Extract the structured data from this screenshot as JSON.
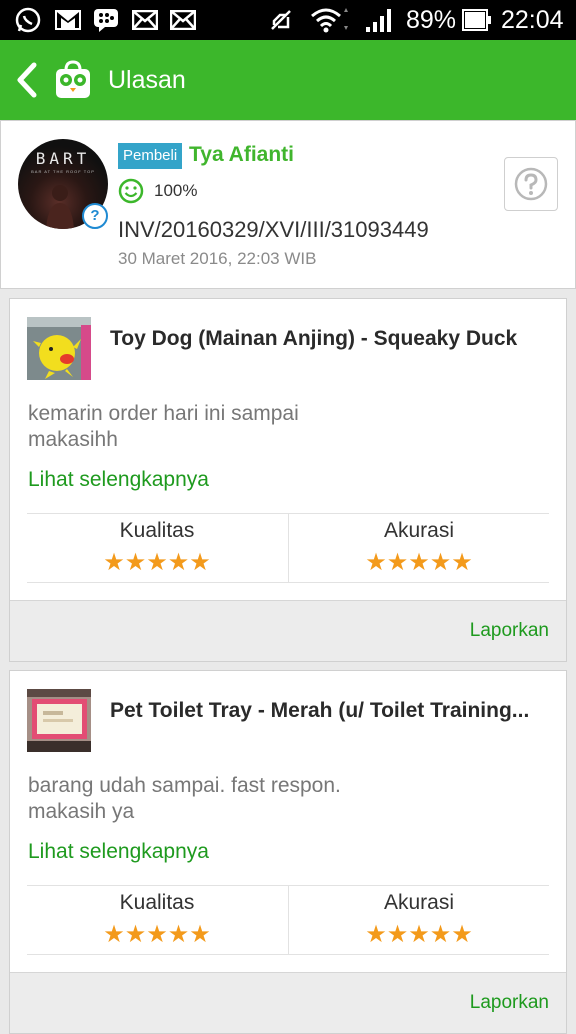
{
  "status_bar": {
    "battery": "89%",
    "time": "22:04",
    "icons": [
      "whatsapp-icon",
      "gmail-icon",
      "bbm-icon",
      "mail-icon",
      "mail-icon",
      "mute-icon",
      "wifi-icon",
      "signal-icon",
      "battery-icon"
    ]
  },
  "app_bar": {
    "title": "Ulasan",
    "back_icon": "back-arrow-icon",
    "logo_icon": "owl-bag-logo-icon",
    "color": "#3cb72b"
  },
  "reviewer": {
    "avatar_text": "BART",
    "avatar_subtext": "BAR AT THE ROOF TOP",
    "role_tag": "Pembeli",
    "name": "Tya Afianti",
    "reputation": "100%",
    "invoice": "INV/20160329/XVI/III/31093449",
    "date": "30 Maret 2016, 22:03 WIB"
  },
  "reviews": [
    {
      "product": "Toy Dog (Mainan Anjing) - Squeaky Duck",
      "message_line1": "kemarin order hari ini sampai",
      "message_line2": "makasihh",
      "more_label": "Lihat selengkapnya",
      "quality_label": "Kualitas",
      "quality_stars": 5,
      "accuracy_label": "Akurasi",
      "accuracy_stars": 5,
      "report_label": "Laporkan"
    },
    {
      "product": "Pet Toilet Tray - Merah (u/ Toilet Training...",
      "message_line1": "barang udah sampai. fast respon.",
      "message_line2": "makasih ya",
      "more_label": "Lihat selengkapnya",
      "quality_label": "Kualitas",
      "quality_stars": 5,
      "accuracy_label": "Akurasi",
      "accuracy_stars": 5,
      "report_label": "Laporkan"
    }
  ],
  "colors": {
    "accent_green": "#3cb72b",
    "link_green": "#1e9a1e",
    "star": "#f39a1b",
    "tag_blue": "#34a4c9"
  }
}
